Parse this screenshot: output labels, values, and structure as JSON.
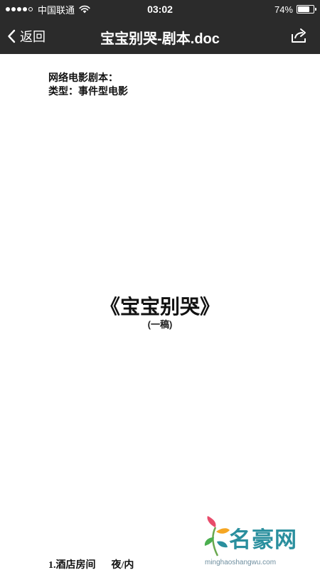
{
  "status_bar": {
    "carrier": "中国联通",
    "time": "03:02",
    "battery_percent": "74%",
    "battery_level": 0.74,
    "signal_strength": 4,
    "signal_max": 5
  },
  "nav_bar": {
    "back_label": "返回",
    "title": "宝宝别哭-剧本.doc",
    "back_icon": "chevron-left-icon",
    "share_icon": "share-icon"
  },
  "document": {
    "meta_line1": "网络电影剧本：",
    "meta_line2": "类型：事件型电影",
    "title": "《宝宝别哭》",
    "draft": "(一稿)",
    "scene_heading": "1.酒店房间",
    "scene_time": "夜/内"
  },
  "watermark": {
    "brand": "名豪网",
    "url": "minghaoshangwu.com"
  },
  "colors": {
    "bar_background": "#2b2b2b",
    "bar_text": "#ffffff",
    "page_background": "#ffffff",
    "watermark_brand": "#2a8f9e"
  }
}
